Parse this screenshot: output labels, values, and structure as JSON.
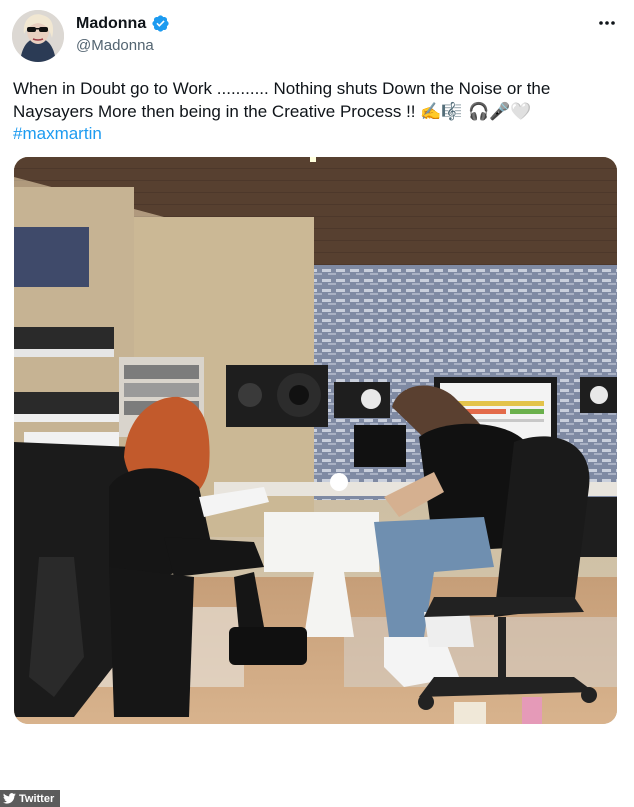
{
  "author": {
    "display_name": "Madonna",
    "handle": "@Madonna"
  },
  "tweet": {
    "text": "When in Doubt go to Work ........... Nothing shuts Down the Noise or the Naysayers More then  being in the Creative Process !! ",
    "emoji": "✍️🎼 🎧🎤🤍",
    "hashtag": "#maxmartin"
  },
  "icons": {
    "verified": "verified-badge-icon",
    "more": "more-options-icon",
    "watermark": "twitter-bird-icon"
  },
  "colors": {
    "verified_blue": "#1d9bf0",
    "hashtag_blue": "#1d9bf0",
    "handle_gray": "#536471"
  },
  "watermark": {
    "label": "Twitter"
  }
}
